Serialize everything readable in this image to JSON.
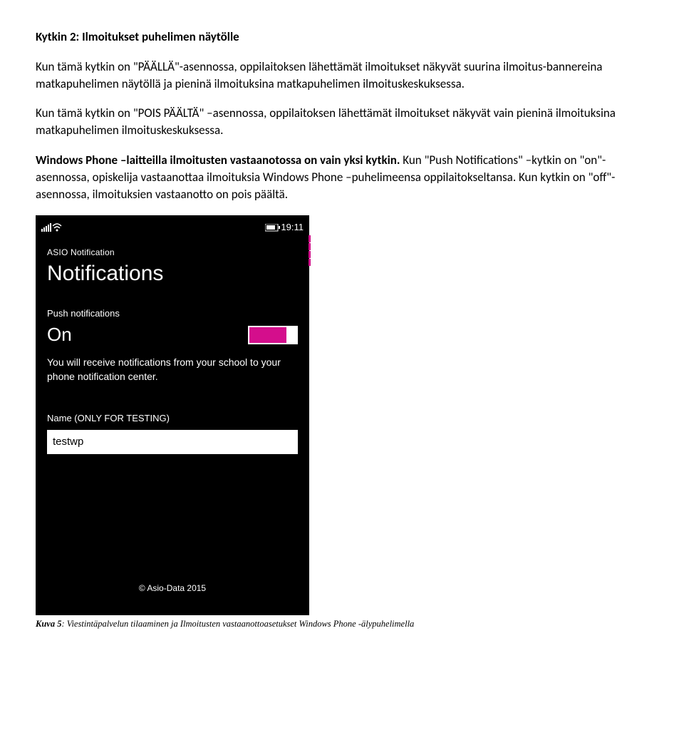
{
  "doc": {
    "heading": "Kytkin 2: Ilmoitukset puhelimen näytölle",
    "para1": "Kun tämä kytkin on \"PÄÄLLÄ\"-asennossa, oppilaitoksen lähettämät ilmoitukset näkyvät suurina ilmoitus-bannereina matkapuhelimen näytöllä ja pieninä ilmoituksina matkapuhelimen ilmoituskeskuksessa.",
    "para2": "Kun tämä kytkin on \"POIS PÄÄLTÄ\" –asennossa, oppilaitoksen lähettämät ilmoitukset näkyvät vain pieninä ilmoituksina matkapuhelimen ilmoituskeskuksessa.",
    "para3a": "Windows Phone –laitteilla ilmoitusten vastaanotossa on vain yksi kytkin.",
    "para3b": " Kun \"Push Notifications\" –kytkin on \"on\"-asennossa, opiskelija vastaanottaa ilmoituksia Windows Phone –puhelimeensa oppilaitokseltansa. Kun kytkin on \"off\"-asennossa, ilmoituksien vastaanotto on pois päältä."
  },
  "phone": {
    "status_time": "19:11",
    "app_name": "ASIO Notification",
    "page_title": "Notifications",
    "push_label": "Push notifications",
    "toggle_state": "On",
    "desc_line": "You will receive notifications from your school to your phone notification center.",
    "name_label": "Name (ONLY FOR TESTING)",
    "name_value": "testwp",
    "copyright": "© Asio-Data 2015"
  },
  "caption": {
    "prefix": "Kuva 5",
    "rest": ": Viestintäpalvelun tilaaminen ja Ilmoitusten vastaanottoasetukset Windows Phone -älypuhelimella"
  }
}
